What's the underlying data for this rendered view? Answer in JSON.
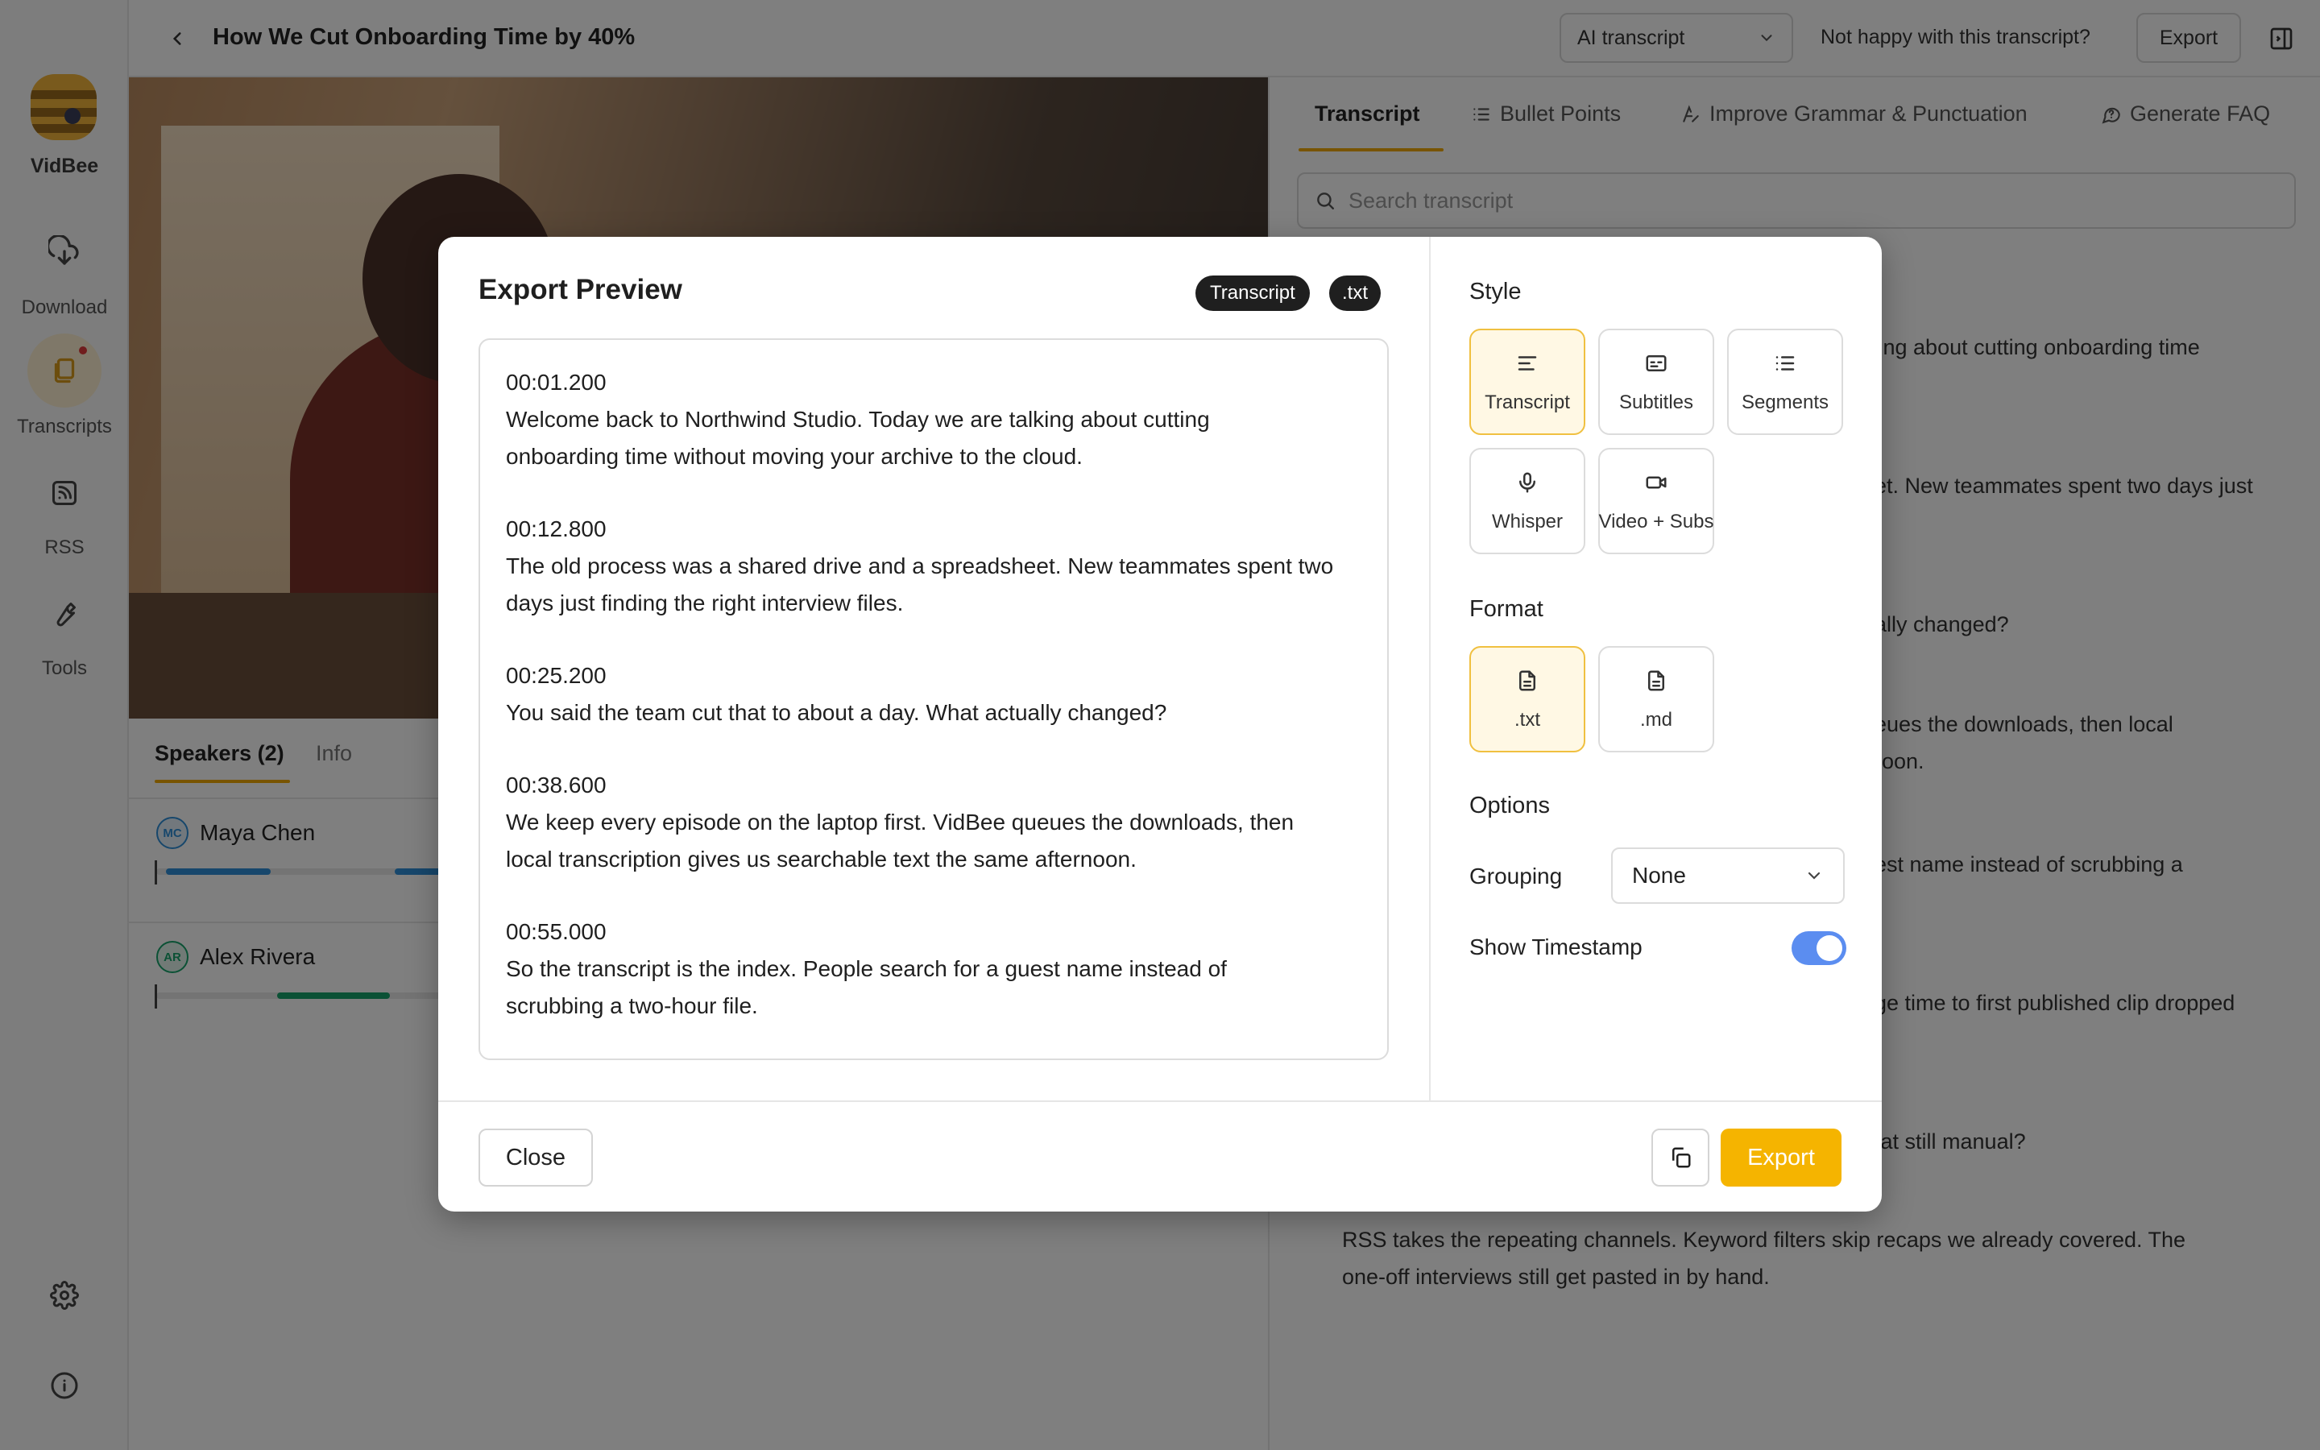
{
  "app": {
    "name": "VidBee"
  },
  "sidebar": {
    "items": [
      {
        "label": "Download",
        "icon": "cloud-download-icon"
      },
      {
        "label": "Transcripts",
        "icon": "transcripts-icon",
        "active": true,
        "badge": true
      },
      {
        "label": "RSS",
        "icon": "rss-icon"
      },
      {
        "label": "Tools",
        "icon": "wrench-icon"
      }
    ],
    "bottom": [
      {
        "icon": "gear-icon"
      },
      {
        "icon": "info-icon"
      }
    ]
  },
  "header": {
    "title": "How We Cut Onboarding Time by 40%",
    "transcript_select": "AI transcript",
    "unhappy_link": "Not happy with this transcript?",
    "export_label": "Export"
  },
  "speakers": {
    "tabs": [
      "Speakers (2)",
      "Info"
    ],
    "list": [
      {
        "initials": "MC",
        "name": "Maya Chen",
        "color": "#2f8fd8"
      },
      {
        "initials": "AR",
        "name": "Alex Rivera",
        "color": "#16a36a"
      }
    ]
  },
  "transcript_panel": {
    "tabs": [
      "Transcript",
      "Bullet Points",
      "Improve Grammar & Punctuation",
      "Generate FAQ"
    ],
    "search_placeholder": "Search transcript",
    "visible_fragments": [
      "lking about cutting onboarding time",
      "eet. New teammates spent two days just",
      "ually changed?",
      "ueues the downloads, then local",
      "rnoon.",
      "uest name instead of scrubbing a",
      "age time to first published clip dropped",
      "that still manual?",
      "RSS takes the repeating channels. Keyword filters skip recaps we already covered. The",
      "one-off interviews still get pasted in by hand."
    ]
  },
  "modal": {
    "title": "Export Preview",
    "chips": [
      "Transcript",
      ".txt"
    ],
    "segments": [
      {
        "ts": "00:01.200",
        "lines": [
          "Welcome back to Northwind Studio. Today we are talking about cutting",
          "onboarding time without moving your archive to the cloud."
        ]
      },
      {
        "ts": "00:12.800",
        "lines": [
          "The old process was a shared drive and a spreadsheet. New teammates spent two",
          "days just finding the right interview files."
        ]
      },
      {
        "ts": "00:25.200",
        "lines": [
          "You said the team cut that to about a day. What actually changed?"
        ]
      },
      {
        "ts": "00:38.600",
        "lines": [
          "We keep every episode on the laptop first. VidBee queues the downloads, then",
          "local transcription gives us searchable text the same afternoon."
        ]
      },
      {
        "ts": "00:55.000",
        "lines": [
          "So the transcript is the index. People search for a guest name instead of",
          "scrubbing a two-hour file."
        ]
      }
    ],
    "style": {
      "heading": "Style",
      "options": [
        "Transcript",
        "Subtitles",
        "Segments",
        "Whisper",
        "Video + Subs"
      ],
      "selected": "Transcript"
    },
    "format": {
      "heading": "Format",
      "options": [
        ".txt",
        ".md"
      ],
      "selected": ".txt"
    },
    "options": {
      "heading": "Options",
      "grouping_label": "Grouping",
      "grouping_value": "None",
      "timestamp_label": "Show Timestamp",
      "timestamp_on": true
    },
    "footer": {
      "close": "Close",
      "export": "Export"
    }
  },
  "colors": {
    "accent": "#f5b400",
    "toggle": "#5b8df0"
  }
}
